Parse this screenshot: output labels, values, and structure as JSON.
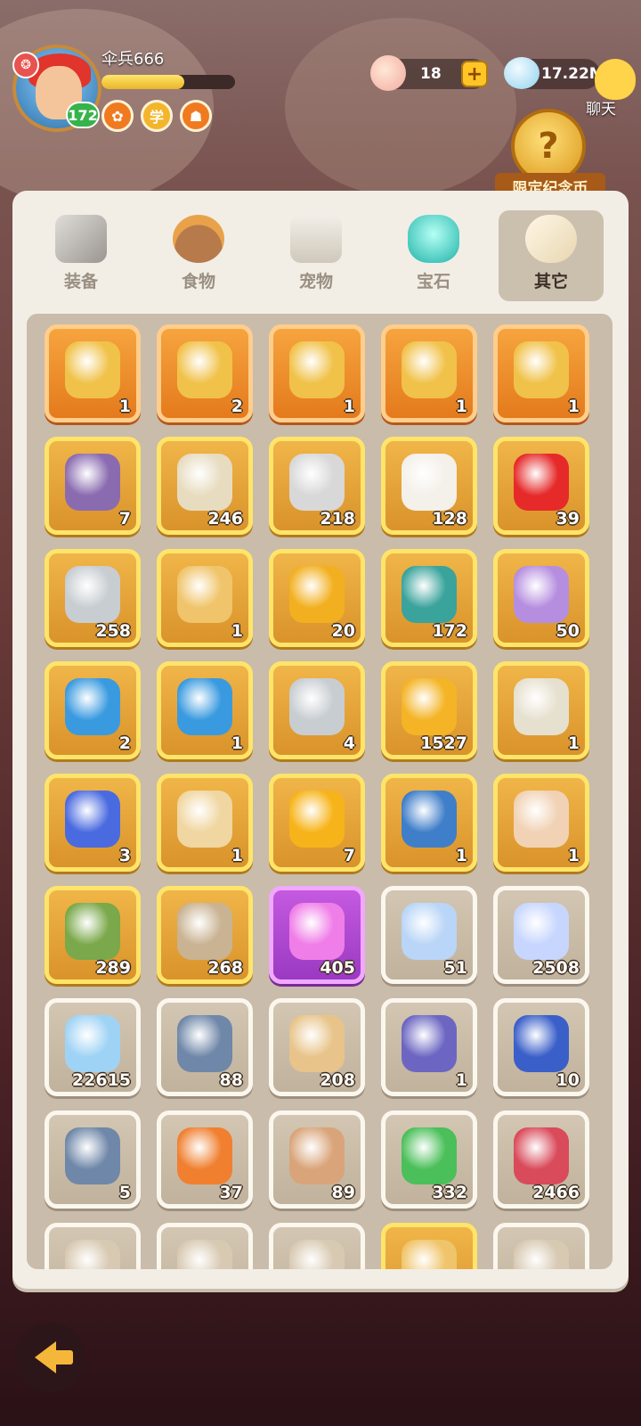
{
  "player": {
    "name": "伞兵666",
    "level": "172",
    "exp_fraction": 0.62
  },
  "currency": {
    "shells": "18",
    "stones": "17.22M"
  },
  "chat": {
    "label": "聊天"
  },
  "promo": {
    "label": "限定纪念币"
  },
  "tabs": [
    {
      "label": "装备"
    },
    {
      "label": "食物"
    },
    {
      "label": "宠物"
    },
    {
      "label": "宝石"
    },
    {
      "label": "其它"
    }
  ],
  "active_tab": "其它",
  "items": [
    {
      "count": "1",
      "rarity": "orange",
      "icon": "pet-crystal-hedgehog-icon",
      "color": "#f1c24a"
    },
    {
      "count": "2",
      "rarity": "orange",
      "icon": "pet-crystal-rider-icon",
      "color": "#f1c24a"
    },
    {
      "count": "1",
      "rarity": "orange",
      "icon": "pet-crystal-bull-icon",
      "color": "#f1c24a"
    },
    {
      "count": "1",
      "rarity": "orange",
      "icon": "pet-crystal-cat-icon",
      "color": "#f1c24a"
    },
    {
      "count": "1",
      "rarity": "orange",
      "icon": "pet-crystal-beetle-icon",
      "color": "#f1c24a"
    },
    {
      "count": "7",
      "rarity": "gold",
      "icon": "purple-chest-icon",
      "color": "#8a6bb0"
    },
    {
      "count": "246",
      "rarity": "gold",
      "icon": "horn-scroll-icon",
      "color": "#e8dcc0"
    },
    {
      "count": "218",
      "rarity": "gold",
      "icon": "pickaxe-icon",
      "color": "#d8d8d8"
    },
    {
      "count": "128",
      "rarity": "gold",
      "icon": "dice-icon",
      "color": "#f4f0ea"
    },
    {
      "count": "39",
      "rarity": "gold",
      "icon": "heart-icon",
      "color": "#e62a2a"
    },
    {
      "count": "258",
      "rarity": "gold",
      "icon": "magnifier-icon",
      "color": "#c8cdd2"
    },
    {
      "count": "1",
      "rarity": "gold",
      "icon": "pet-card-icon",
      "color": "#f0c46a"
    },
    {
      "count": "20",
      "rarity": "gold",
      "icon": "cake-coin-icon",
      "color": "#f2b020"
    },
    {
      "count": "172",
      "rarity": "gold",
      "icon": "carrot-bag-icon",
      "color": "#3aa39c"
    },
    {
      "count": "50",
      "rarity": "gold",
      "icon": "bunny-bag-icon",
      "color": "#b68ee0"
    },
    {
      "count": "2",
      "rarity": "gold",
      "icon": "blue-bag-icon",
      "color": "#3a9ae0"
    },
    {
      "count": "1",
      "rarity": "gold",
      "icon": "blue-bag-icon",
      "color": "#3a9ae0"
    },
    {
      "count": "4",
      "rarity": "gold",
      "icon": "magnifier-icon",
      "color": "#c8cdd2"
    },
    {
      "count": "1527",
      "rarity": "gold",
      "icon": "spiral-coin-icon",
      "color": "#f4b426"
    },
    {
      "count": "1",
      "rarity": "gold",
      "icon": "egg-nest-icon",
      "color": "#e6e0cf"
    },
    {
      "count": "3",
      "rarity": "gold",
      "icon": "paw-badge-icon",
      "color": "#4a6ae0"
    },
    {
      "count": "1",
      "rarity": "gold",
      "icon": "map-scroll-icon",
      "color": "#f0d6a0"
    },
    {
      "count": "7",
      "rarity": "gold",
      "icon": "amber-egg-icon",
      "color": "#f7b41a"
    },
    {
      "count": "1",
      "rarity": "gold",
      "icon": "blue-ticket-icon",
      "color": "#3f7ec9"
    },
    {
      "count": "1",
      "rarity": "gold",
      "icon": "sleeping-boy-icon",
      "color": "#f1d2b4"
    },
    {
      "count": "289",
      "rarity": "gold",
      "icon": "green-statue-icon",
      "color": "#7aa84a"
    },
    {
      "count": "268",
      "rarity": "gold",
      "icon": "stone-statue-icon",
      "color": "#c9b392"
    },
    {
      "count": "405",
      "rarity": "purple",
      "icon": "pink-crystal-icon",
      "color": "#f07ee8"
    },
    {
      "count": "51",
      "rarity": "white",
      "icon": "moon-icon",
      "color": "#b9d5f7"
    },
    {
      "count": "2508",
      "rarity": "white",
      "icon": "star-icon",
      "color": "#c7d6ff"
    },
    {
      "count": "22615",
      "rarity": "white",
      "icon": "prism-icon",
      "color": "#9fd3f5"
    },
    {
      "count": "88",
      "rarity": "white",
      "icon": "silver-chest-icon",
      "color": "#6f87a8"
    },
    {
      "count": "208",
      "rarity": "white",
      "icon": "leopard-bag-icon",
      "color": "#e8c48a"
    },
    {
      "count": "1",
      "rarity": "white",
      "icon": "figure-card-icon",
      "color": "#6c66c2"
    },
    {
      "count": "10",
      "rarity": "white",
      "icon": "blue-gem-icon",
      "color": "#3a5fc9"
    },
    {
      "count": "5",
      "rarity": "white",
      "icon": "silver-chest-icon",
      "color": "#6f87a8"
    },
    {
      "count": "37",
      "rarity": "white",
      "icon": "orange-scroll-icon",
      "color": "#f08030"
    },
    {
      "count": "89",
      "rarity": "white",
      "icon": "paw-scroll-icon",
      "color": "#d9a47a"
    },
    {
      "count": "332",
      "rarity": "white",
      "icon": "green-ticket-icon",
      "color": "#4bbf5a"
    },
    {
      "count": "2466",
      "rarity": "white",
      "icon": "red-ticket-icon",
      "color": "#d94a5a"
    },
    {
      "count": "",
      "rarity": "white",
      "icon": "partial-item-icon",
      "color": "#d8c9b2"
    },
    {
      "count": "",
      "rarity": "white",
      "icon": "partial-item-icon",
      "color": "#d8c9b2"
    },
    {
      "count": "",
      "rarity": "white",
      "icon": "partial-item-icon",
      "color": "#d8c9b2"
    },
    {
      "count": "",
      "rarity": "gold",
      "icon": "partial-item-icon",
      "color": "#f0c46a"
    },
    {
      "count": "",
      "rarity": "white",
      "icon": "partial-item-icon",
      "color": "#d8c9b2"
    }
  ]
}
